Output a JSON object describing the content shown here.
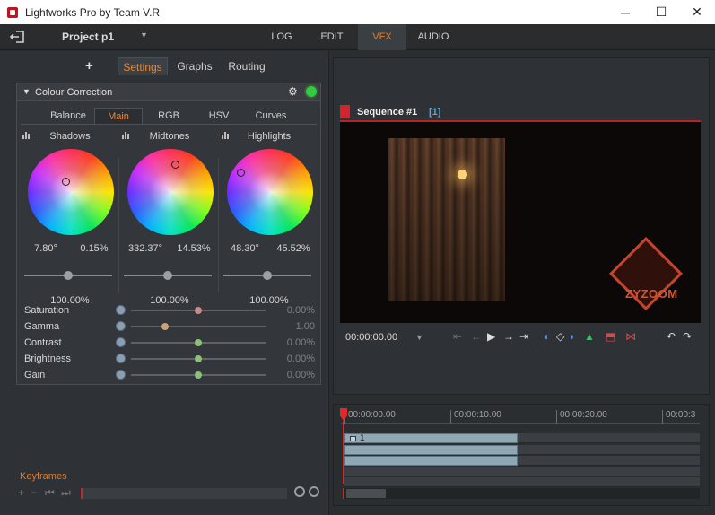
{
  "window": {
    "title": "Lightworks Pro by Team V.R",
    "minimize": "─",
    "maximize": "☐",
    "close": "✕"
  },
  "topnav": {
    "project_name": "Project p1",
    "project_dropdown": "▼",
    "tabs": [
      {
        "label": "LOG",
        "active": false
      },
      {
        "label": "EDIT",
        "active": false
      },
      {
        "label": "VFX",
        "active": true
      },
      {
        "label": "AUDIO",
        "active": false
      }
    ]
  },
  "left_panel": {
    "add_label": "+",
    "tabs": [
      {
        "label": "Settings",
        "active": true
      },
      {
        "label": "Graphs",
        "active": false
      },
      {
        "label": "Routing",
        "active": false
      }
    ],
    "effect": {
      "title": "Colour Correction",
      "collapse_glyph": "▼",
      "gear_glyph": "⚙",
      "enabled": true,
      "subtabs": [
        {
          "label": "Balance",
          "active": false
        },
        {
          "label": "Main",
          "active": true
        },
        {
          "label": "RGB",
          "active": false
        },
        {
          "label": "HSV",
          "active": false
        },
        {
          "label": "Curves",
          "active": false
        }
      ],
      "wheels": [
        {
          "label": "Shadows",
          "angle": "7.80°",
          "saturation": "0.15%",
          "level": "100.00%"
        },
        {
          "label": "Midtones",
          "angle": "332.37°",
          "saturation": "14.53%",
          "level": "100.00%"
        },
        {
          "label": "Highlights",
          "angle": "48.30°",
          "saturation": "45.52%",
          "level": "100.00%"
        }
      ],
      "params": [
        {
          "label": "Saturation",
          "value": "0.00%",
          "knob_color": "#c98a8a",
          "position": 0.5
        },
        {
          "label": "Gamma",
          "value": "1.00",
          "knob_color": "#c9a27a",
          "position": 0.25
        },
        {
          "label": "Contrast",
          "value": "0.00%",
          "knob_color": "#8fbf7a",
          "position": 0.5
        },
        {
          "label": "Brightness",
          "value": "0.00%",
          "knob_color": "#8fbf7a",
          "position": 0.5
        },
        {
          "label": "Gain",
          "value": "0.00%",
          "knob_color": "#8fbf7a",
          "position": 0.5
        }
      ]
    },
    "keyframes": {
      "label": "Keyframes",
      "add_glyph": "+",
      "remove_glyph": "−",
      "prev_glyph": "⏮",
      "next_glyph": "⏭"
    }
  },
  "viewer": {
    "sequence_title": "Sequence #1",
    "sequence_count": "[1]",
    "watermark": "ZYZOOM",
    "timecode": "00:00:00.00",
    "timecode_dropdown": "▼",
    "transport": {
      "go_start": "⇤",
      "step_back": "←",
      "play": "▶",
      "step_forward": "→",
      "go_end": "⇥",
      "mark_in": "◖",
      "mark_clear": "◇",
      "mark_out": "◗",
      "cue": "▲",
      "insert": "⬒",
      "replace": "⋈",
      "undo": "↶",
      "redo": "↷"
    }
  },
  "timeline": {
    "ticks": [
      "00:00:00.00",
      "00:00:10.00",
      "00:00:20.00",
      "00:00:3"
    ],
    "clip_label": "1"
  }
}
